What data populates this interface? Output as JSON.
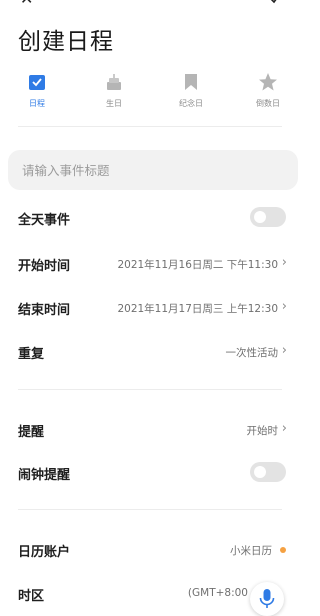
{
  "header": {
    "title": "创建日程"
  },
  "tabs": [
    {
      "label": "日程",
      "icon": "calendar-check-icon",
      "active": true
    },
    {
      "label": "生日",
      "icon": "cake-icon",
      "active": false
    },
    {
      "label": "纪念日",
      "icon": "bookmark-icon",
      "active": false
    },
    {
      "label": "倒数日",
      "icon": "star-icon",
      "active": false
    }
  ],
  "event_title": {
    "placeholder": "请输入事件标题",
    "value": ""
  },
  "rows": {
    "all_day": {
      "label": "全天事件",
      "toggle_on": false
    },
    "start_time": {
      "label": "开始时间",
      "value": "2021年11月16日周二 下午11:30"
    },
    "end_time": {
      "label": "结束时间",
      "value": "2021年11月17日周三 上午12:30"
    },
    "repeat": {
      "label": "重复",
      "value": "一次性活动"
    },
    "reminder": {
      "label": "提醒",
      "value": "开始时"
    },
    "alarm_reminder": {
      "label": "闹钟提醒",
      "toggle_on": false
    },
    "calendar_account": {
      "label": "日历账户",
      "value": "小米日历"
    },
    "timezone": {
      "label": "时区",
      "value": "(GMT+8:00"
    }
  },
  "colors": {
    "accent": "#2f7be5",
    "account_dot": "#f5a142",
    "toggle_off": "#e3e3e3",
    "input_bg": "#f2f2f2"
  }
}
